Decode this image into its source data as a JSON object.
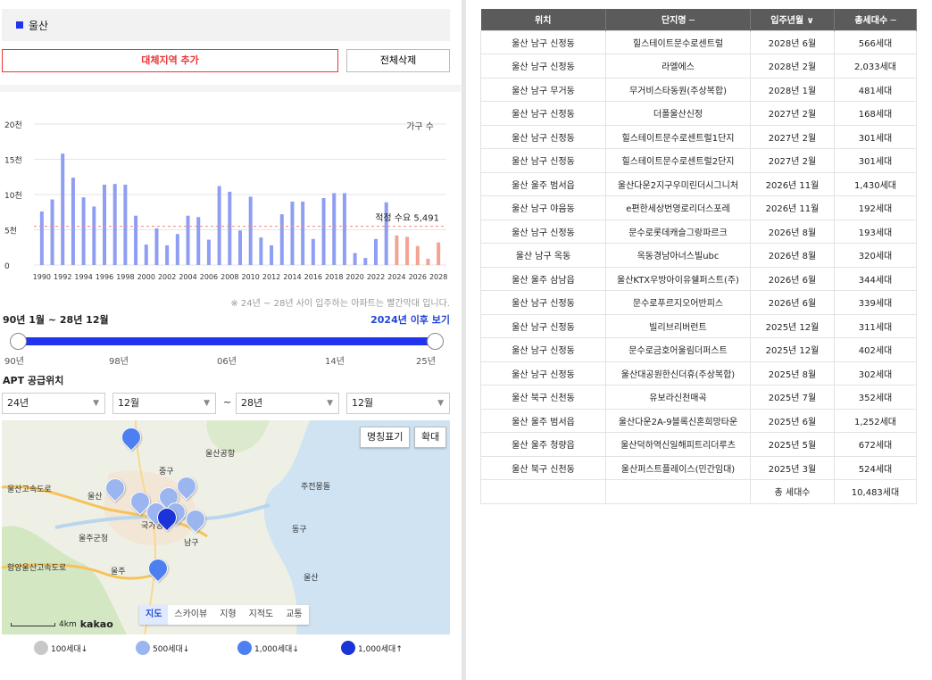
{
  "region": {
    "name": "울산",
    "color": "#2233ee"
  },
  "buttons": {
    "add_alt": "대체지역 추가",
    "delete_all": "전체삭제"
  },
  "chart_data": {
    "type": "bar",
    "title": "",
    "legend_label": "가구 수",
    "y_ticks": [
      "0",
      "5천",
      "10천",
      "15천",
      "20천"
    ],
    "ylim": [
      0,
      20000
    ],
    "x_tick_labels": [
      "1990",
      "1992",
      "1994",
      "1996",
      "1998",
      "2000",
      "2002",
      "2004",
      "2006",
      "2008",
      "2010",
      "2012",
      "2014",
      "2016",
      "2018",
      "2020",
      "2022",
      "2024",
      "2026",
      "2028"
    ],
    "categories": [
      1990,
      1991,
      1992,
      1993,
      1994,
      1995,
      1996,
      1997,
      1998,
      1999,
      2000,
      2001,
      2002,
      2003,
      2004,
      2005,
      2006,
      2007,
      2008,
      2009,
      2010,
      2011,
      2012,
      2013,
      2014,
      2015,
      2016,
      2017,
      2018,
      2019,
      2020,
      2021,
      2022,
      2023,
      2024,
      2025,
      2026,
      2027,
      2028
    ],
    "values": [
      7600,
      9300,
      15800,
      12400,
      9600,
      8300,
      11400,
      11500,
      11400,
      7000,
      2900,
      5200,
      2800,
      4400,
      7000,
      6800,
      3600,
      11200,
      10400,
      4900,
      9700,
      3900,
      2800,
      7200,
      9000,
      9000,
      3700,
      9500,
      10200,
      10200,
      1700,
      1000,
      3700,
      8900,
      4200,
      4000,
      2700,
      900,
      3200
    ],
    "highlight_from": 2024,
    "reference_line": {
      "value": 5491,
      "label": "적정 수요 5,491"
    }
  },
  "chart_note": "※ 24년 ~ 28년 사이 입주하는 아파트는 빨간막대 입니다.",
  "period": {
    "label": "90년 1월 ~ 28년 12월",
    "link": "2024년 이후 보기"
  },
  "slider": {
    "ticks": [
      "90년",
      "98년",
      "06년",
      "14년",
      "25년"
    ]
  },
  "apt": {
    "label": "APT 공급위치",
    "from_year": "24년",
    "from_month": "12월",
    "tilde": "~",
    "to_year": "28년",
    "to_month": "12월"
  },
  "map": {
    "btn_names": "명칭표기",
    "btn_zoom": "확대",
    "tabs": [
      "지도",
      "스카이뷰",
      "지형",
      "지적도",
      "교통"
    ],
    "scale": "4km",
    "logo": "kakao",
    "labels": [
      "울산공항",
      "중구",
      "울산",
      "주전몽돌",
      "동구",
      "울주군청",
      "울주",
      "남구",
      "국가정",
      "울산",
      "울산고속도로",
      "함양울산고속도로"
    ]
  },
  "legend": [
    "100세대↓",
    "500세대↓",
    "1,000세대↓",
    "1,000세대↑"
  ],
  "table": {
    "headers": [
      "위치",
      "단지명 ─",
      "입주년월 ∨",
      "총세대수 ─"
    ],
    "rows": [
      [
        "울산 남구 신정동",
        "힐스테이트문수로센트럴",
        "2028년 6월",
        "566세대"
      ],
      [
        "울산 남구 신정동",
        "라엘에스",
        "2028년 2월",
        "2,033세대"
      ],
      [
        "울산 남구 무거동",
        "무거비스타동원(주상복합)",
        "2028년 1월",
        "481세대"
      ],
      [
        "울산 남구 신정동",
        "더폴울산신정",
        "2027년 2월",
        "168세대"
      ],
      [
        "울산 남구 신정동",
        "힐스테이트문수로센트럴1단지",
        "2027년 2월",
        "301세대"
      ],
      [
        "울산 남구 신정동",
        "힐스테이트문수로센트럴2단지",
        "2027년 2월",
        "301세대"
      ],
      [
        "울산 울주 범서읍",
        "울산다운2지구우미린더시그니처",
        "2026년 11월",
        "1,430세대"
      ],
      [
        "울산 남구 야음동",
        "e편한세상번영로리더스포레",
        "2026년 11월",
        "192세대"
      ],
      [
        "울산 남구 신정동",
        "문수로롯데캐슬그랑파르크",
        "2026년 8월",
        "193세대"
      ],
      [
        "울산 남구 옥동",
        "옥동경남아너스빌ubc",
        "2026년 8월",
        "320세대"
      ],
      [
        "울산 울주 삼남읍",
        "울산KTX우방아이유쉘퍼스트(주)",
        "2026년 6월",
        "344세대"
      ],
      [
        "울산 남구 신정동",
        "문수로푸르지오어반피스",
        "2026년 6월",
        "339세대"
      ],
      [
        "울산 남구 신정동",
        "빌리브리버런트",
        "2025년 12월",
        "311세대"
      ],
      [
        "울산 남구 신정동",
        "문수로금호어울림더퍼스트",
        "2025년 12월",
        "402세대"
      ],
      [
        "울산 남구 신정동",
        "울산대공원한신더휴(주상복합)",
        "2025년 8월",
        "302세대"
      ],
      [
        "울산 북구 신천동",
        "유보라신천매곡",
        "2025년 7월",
        "352세대"
      ],
      [
        "울산 울주 범서읍",
        "울산다운2A-9블록신혼희망타운",
        "2025년 6월",
        "1,252세대"
      ],
      [
        "울산 울주 청량읍",
        "울산덕하역신일해피트리더루츠",
        "2025년 5월",
        "672세대"
      ],
      [
        "울산 북구 신천동",
        "울산퍼스트플레이스(민간임대)",
        "2025년 3월",
        "524세대"
      ]
    ],
    "total_label": "총 세대수",
    "total_value": "10,483세대"
  }
}
